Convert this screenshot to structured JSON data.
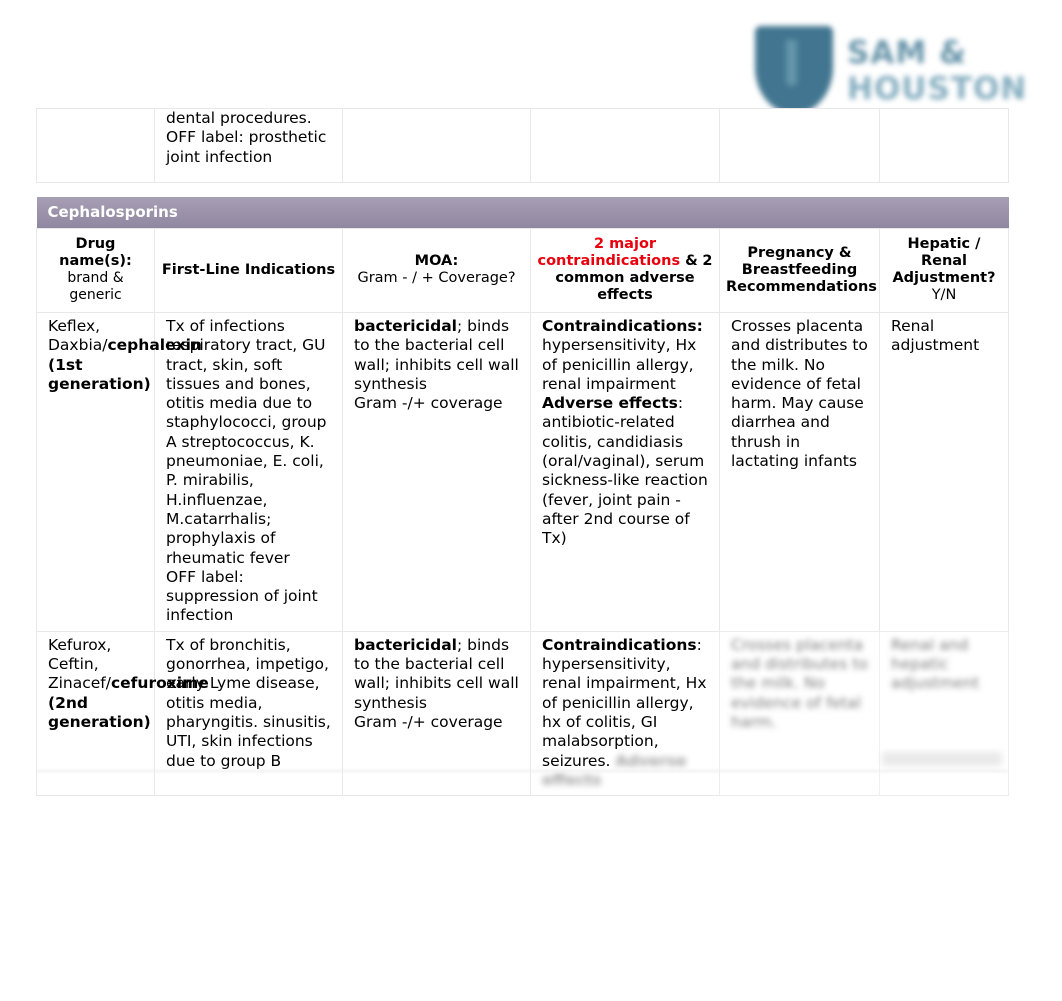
{
  "logo": {
    "shield_icon": "shield-icon",
    "line1": "SAM &",
    "line2": "HOUSTON",
    "color": "#336b87"
  },
  "table": {
    "section_band_label": "Cephalosporins",
    "band_color": "#9b92aa",
    "accent_red": "#e8000d",
    "top_partial_row": {
      "drug": "",
      "indications": "dental procedures.\nOFF label: prosthetic joint infection",
      "moa": "",
      "contraindications": "",
      "pregnancy": "",
      "adjustment": ""
    },
    "headers": {
      "drug_name": {
        "strong": "Drug name(s):",
        "sub": "brand & generic"
      },
      "indications": {
        "strong": "First-Line Indications",
        "sub": ""
      },
      "moa": {
        "strong": "MOA:",
        "sub": "Gram - / + Coverage?"
      },
      "contraindications": {
        "red": "2 major contraindications",
        "amp": " &",
        "rest": "2 common adverse effects"
      },
      "pregnancy": {
        "strong": "Pregnancy & Breastfeeding Recommendations",
        "sub": ""
      },
      "adjustment": {
        "strong": "Hepatic / Renal Adjustment?",
        "sub": "Y/N"
      }
    },
    "rows": [
      {
        "drug_plain": "Keflex, Daxbia/",
        "drug_bold": "cephalexin (1st generation)",
        "indications": "Tx of infections respiratory tract, GU tract, skin, soft tissues and bones, otitis media due to staphylococci, group A streptococcus, K. pneumoniae, E. coli, P. mirabilis, H.influenzae, M.catarrhalis; prophylaxis of rheumatic fever\nOFF label: suppression of joint infection",
        "moa_bold": "bactericidal",
        "moa_rest": "; binds to the bacterial cell wall; inhibits cell wall synthesis",
        "moa_gram": "Gram  -/+ coverage",
        "contra_label": "Contraindications:",
        "contra_text": "hypersensitivity, Hx of penicillin allergy, renal impairment",
        "adverse_label": "Adverse effects",
        "adverse_text": ": antibiotic-related colitis, candidiasis (oral/vaginal), serum sickness-like reaction (fever, joint pain - after 2nd course of Tx)",
        "pregnancy": "Crosses placenta and distributes to the milk. No evidence of fetal harm. May cause diarrhea and thrush in lactating infants",
        "adjustment": "Renal adjustment",
        "faded": false
      },
      {
        "drug_plain": "Kefurox, Ceftin, Zinacef/",
        "drug_bold": "cefuroxime (2nd generation)",
        "indications": "Tx of bronchitis, gonorrhea, impetigo, early Lyme disease, otitis media, pharyngitis. sinusitis, UTI, skin infections due to group B",
        "moa_bold": "bactericidal",
        "moa_rest": "; binds to the bacterial cell wall; inhibits cell wall synthesis",
        "moa_gram": "Gram  -/+ coverage",
        "contra_label": "Contraindications",
        "contra_text": ": hypersensitivity, renal impairment, Hx of penicillin allergy, hx of colitis, GI malabsorption, seizures.",
        "adverse_label": "Adverse effects",
        "adverse_text": "",
        "pregnancy": "Crosses placenta and distributes to the milk. No evidence of fetal harm.",
        "adjustment": "Renal and hepatic adjustment",
        "faded": true
      }
    ]
  }
}
